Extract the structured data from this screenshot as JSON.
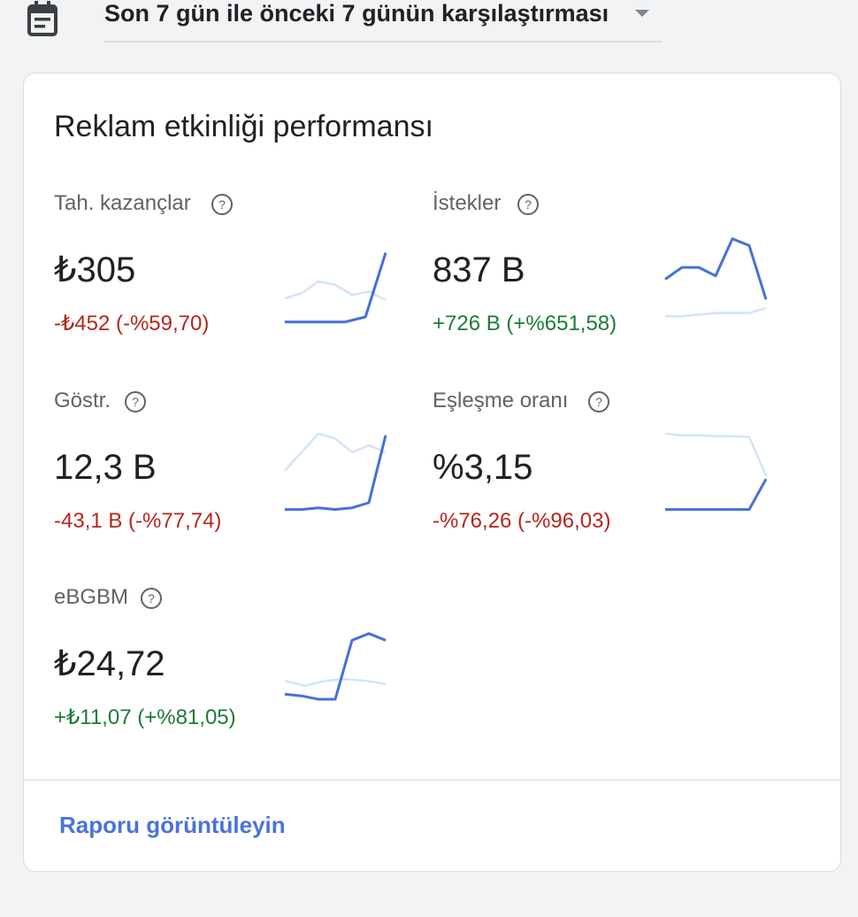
{
  "date_range": {
    "label": "Son 7 gün ile önceki 7 günün karşılaştırması"
  },
  "card": {
    "title": "Reklam etkinliği performansı",
    "metrics": [
      {
        "label": "Tah. kazançlar",
        "value": "₺305",
        "delta": "-₺452 (-%59,70)",
        "trend": "negative",
        "current_series": [
          14,
          14,
          14,
          14,
          20,
          96
        ],
        "previous_series": [
          42,
          48,
          62,
          58,
          46,
          50,
          40
        ]
      },
      {
        "label": "İstekler",
        "value": "837 B",
        "delta": "+726 B (+%651,58)",
        "trend": "positive",
        "current_series": [
          52,
          66,
          66,
          56,
          100,
          92,
          28
        ],
        "previous_series": [
          8,
          8,
          10,
          12,
          12,
          12,
          18
        ]
      },
      {
        "label": "Göstr.",
        "value": "12,3 B",
        "delta": "-43,1 B (-%77,74)",
        "trend": "negative",
        "current_series": [
          12,
          12,
          14,
          12,
          14,
          20,
          100
        ],
        "previous_series": [
          58,
          80,
          102,
          96,
          80,
          88,
          80
        ]
      },
      {
        "label": "Eşleşme oranı",
        "value": "%3,15",
        "delta": "-%76,26 (-%96,03)",
        "trend": "negative",
        "current_series": [
          12,
          12,
          12,
          12,
          12,
          12,
          48
        ],
        "previous_series": [
          102,
          100,
          100,
          99,
          99,
          98,
          52
        ]
      },
      {
        "label": "eBGBM",
        "value": "₺24,72",
        "delta": "+₺11,07 (+%81,05)",
        "trend": "positive",
        "current_series": [
          28,
          26,
          22,
          22,
          92,
          100,
          92
        ],
        "previous_series": [
          44,
          38,
          44,
          46,
          44,
          40
        ]
      }
    ],
    "report_link": "Raporu görüntüleyin"
  },
  "colors": {
    "current_line": "#4472d6",
    "previous_line": "#d2e3fc",
    "negative_delta": "#b3261e",
    "positive_delta": "#1e7a3a",
    "link": "#4a73d9"
  },
  "icons": [
    "calendar-icon",
    "dropdown-caret-icon",
    "help-icon"
  ]
}
